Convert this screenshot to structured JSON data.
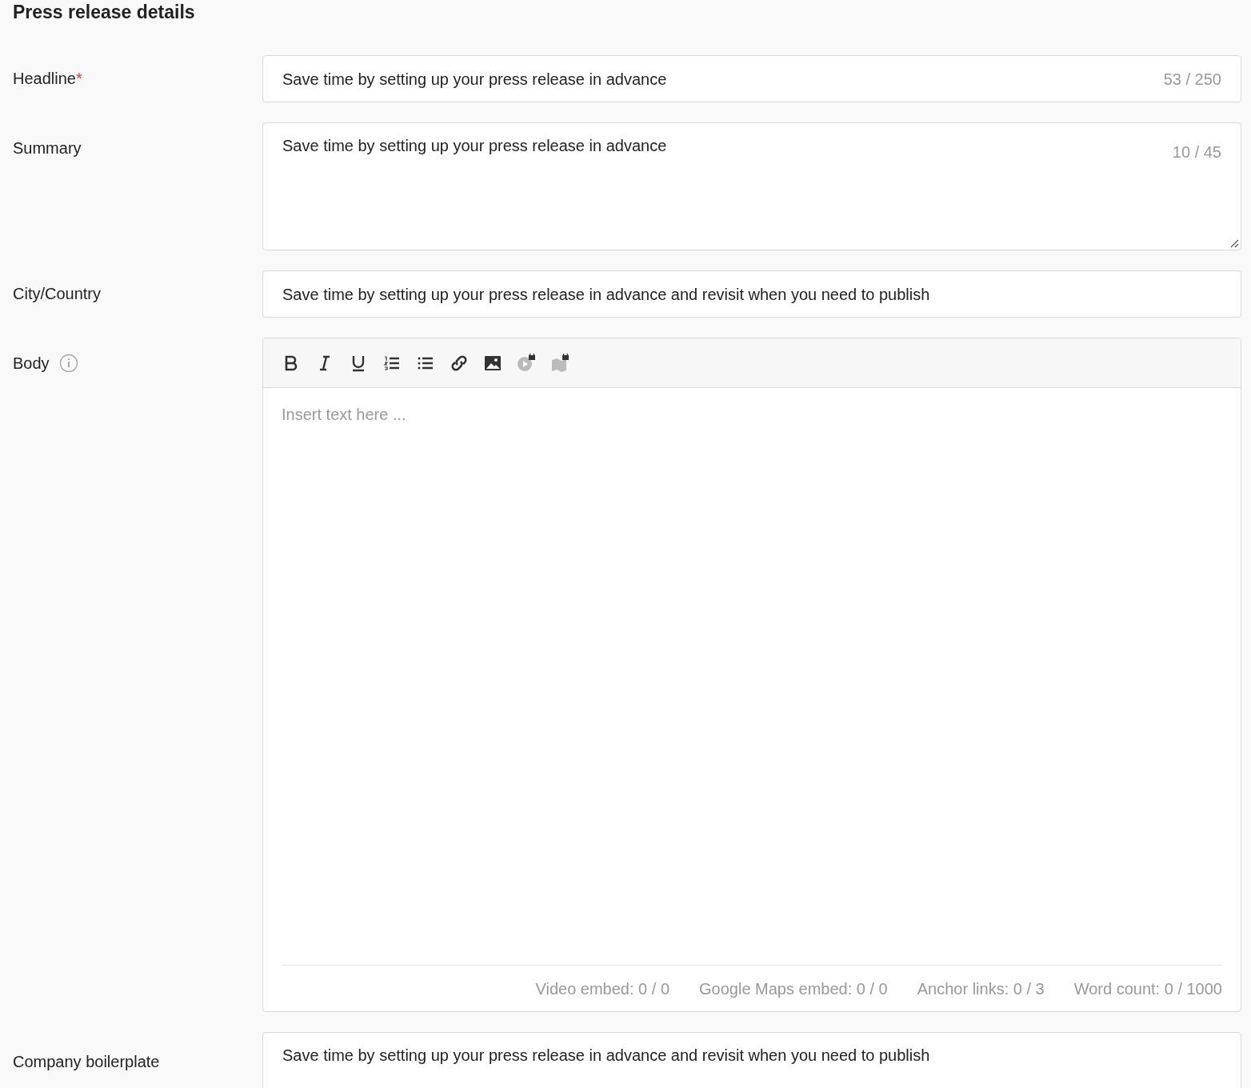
{
  "section_title": "Press release details",
  "fields": [
    {
      "kind": "input",
      "label": "Headline",
      "required_mark": "*",
      "value": "Save time by setting up your press release in advance",
      "counter": "53 / 250"
    },
    {
      "kind": "textarea",
      "label": "Summary",
      "value": "Save time by setting up your press release in advance",
      "counter": "10 / 45"
    },
    {
      "kind": "input",
      "label": "City/Country",
      "value": "Save time by setting up your press release in advance and revisit when you need to publish"
    },
    {
      "kind": "editor",
      "label": "Body",
      "info": true,
      "placeholder": "Insert text here ...",
      "toolbar": [
        {
          "kind": "bold",
          "locked": false
        },
        {
          "kind": "italic",
          "locked": false
        },
        {
          "kind": "underline",
          "locked": false
        },
        {
          "kind": "ordered-list",
          "locked": false
        },
        {
          "kind": "bullet-list",
          "locked": false
        },
        {
          "kind": "link",
          "locked": false
        },
        {
          "kind": "image",
          "locked": false
        },
        {
          "kind": "video",
          "locked": true
        },
        {
          "kind": "map",
          "locked": true
        }
      ],
      "stats": [
        "Video embed: 0 / 0",
        "Google Maps embed: 0 / 0",
        "Anchor links: 0 / 3",
        "Word count: 0 / 1000"
      ]
    },
    {
      "kind": "boilerplate",
      "label": "Company boilerplate",
      "value": "Save time by setting up your press release in advance and revisit when you need to publish"
    }
  ]
}
